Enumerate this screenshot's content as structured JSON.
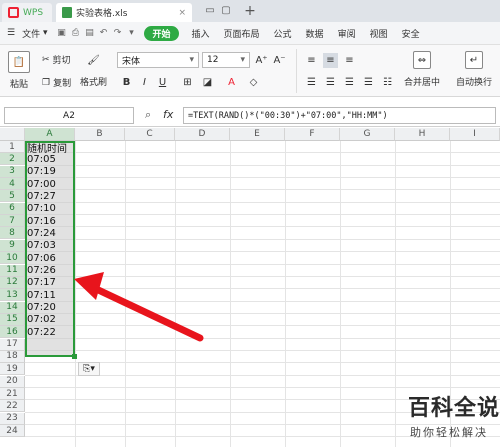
{
  "titlebar": {
    "app_tab": "WPS",
    "file_tab": "实验表格.xls",
    "new_tab": "+"
  },
  "menubar": {
    "file_menu": "文件",
    "items": [
      "开始",
      "插入",
      "页面布局",
      "公式",
      "数据",
      "审阅",
      "视图",
      "安全"
    ]
  },
  "ribbon": {
    "paste": "粘贴",
    "cut": "剪切",
    "copy": "复制",
    "format_painter": "格式刷",
    "font_name": "宋体",
    "font_size": "12",
    "merge_center": "合并居中",
    "wrap_text": "自动换行"
  },
  "formula_bar": {
    "name_box": "A2",
    "fx": "fx",
    "formula": "=TEXT(RAND()*(\"00:30\")+\"07:00\",\"HH:MM\")"
  },
  "sheet": {
    "columns": [
      "A",
      "B",
      "C",
      "D",
      "E",
      "F",
      "G",
      "H",
      "I"
    ],
    "rows": [
      "1",
      "2",
      "3",
      "4",
      "5",
      "6",
      "7",
      "8",
      "9",
      "10",
      "11",
      "12",
      "13",
      "14",
      "15",
      "16",
      "17",
      "18",
      "19",
      "20",
      "21",
      "22",
      "23",
      "24"
    ],
    "col_a": [
      "随机时间",
      "07:05",
      "07:19",
      "07:00",
      "07:27",
      "07:10",
      "07:16",
      "07:24",
      "07:03",
      "07:06",
      "07:26",
      "07:17",
      "07:11",
      "07:20",
      "07:02",
      "07:22"
    ]
  },
  "watermark": {
    "title": "百科全说",
    "subtitle": "助你轻松解决"
  },
  "colors": {
    "start_green": "#2eaa44",
    "selection_border": "#2a9a3a",
    "arrow_red": "#e8141c"
  }
}
